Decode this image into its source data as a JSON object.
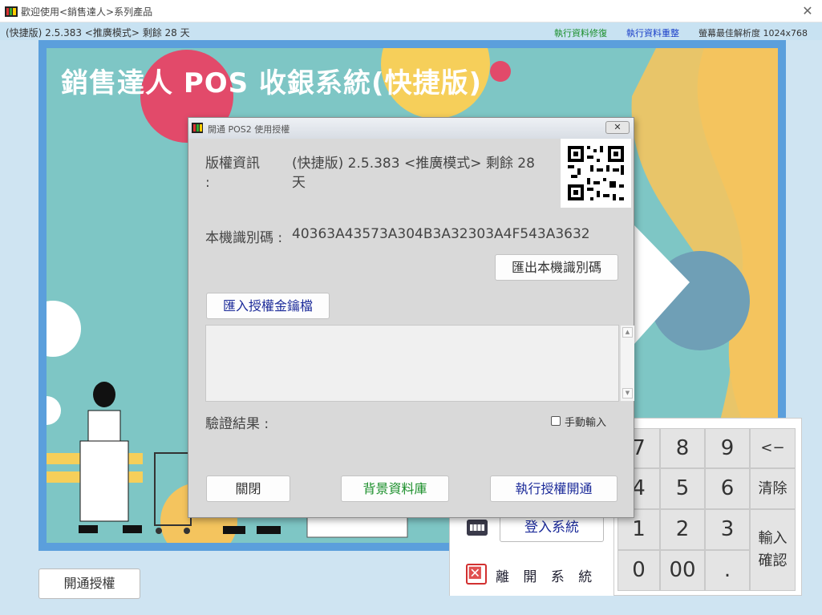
{
  "window": {
    "title": "歡迎使用<銷售達人>系列產品",
    "close_symbol": "✕"
  },
  "infobar": {
    "version": "(快捷版) 2.5.383 <推廣模式> 剩餘 28 天",
    "link_repair": "執行資料修復",
    "link_reset": "執行資料重整",
    "resolution": "螢幕最佳解析度 1024x768"
  },
  "banner": {
    "title": "銷售達人 POS 收銀系統(快捷版)"
  },
  "buttons": {
    "open_auth": "開通授權",
    "login": "登入系統",
    "exit": "離 開 系 統"
  },
  "keypad": {
    "keys": [
      "7",
      "8",
      "9",
      "<−",
      "4",
      "5",
      "6",
      "清除",
      "1",
      "2",
      "3",
      "輸入確認",
      "0",
      "00",
      "."
    ]
  },
  "dialog": {
    "title": "開通 POS2 使用授權",
    "close_symbol": "✕",
    "copyright_label": "版權資訊\n:",
    "copyright_value": "(快捷版) 2.5.383 <推廣模式> 剩餘 28\n天",
    "machine_id_label": "本機識別碼 :",
    "machine_id_value": "40363A43573A304B3A32303A4F543A3632",
    "export_btn": "匯出本機識別碼",
    "import_btn": "匯入授權金鑰檔",
    "license_text": "",
    "verify_label": "驗證結果 :",
    "manual_input_label": "手動輸入",
    "manual_input_checked": false,
    "close_btn": "關閉",
    "db_btn": "背景資料庫",
    "activate_btn": "執行授權開通",
    "scroll_up": "▲",
    "scroll_down": "▼"
  },
  "colors": {
    "accent_link_green": "#1a8f2a",
    "accent_link_blue": "#1a3ec8",
    "banner_frame": "#5b9fdc",
    "banner_bg": "#7ec6c5"
  },
  "icons": [
    "app-icon",
    "close-icon",
    "qr-code-icon",
    "keyboard-icon",
    "exit-icon",
    "scroll-up-icon",
    "scroll-down-icon"
  ]
}
